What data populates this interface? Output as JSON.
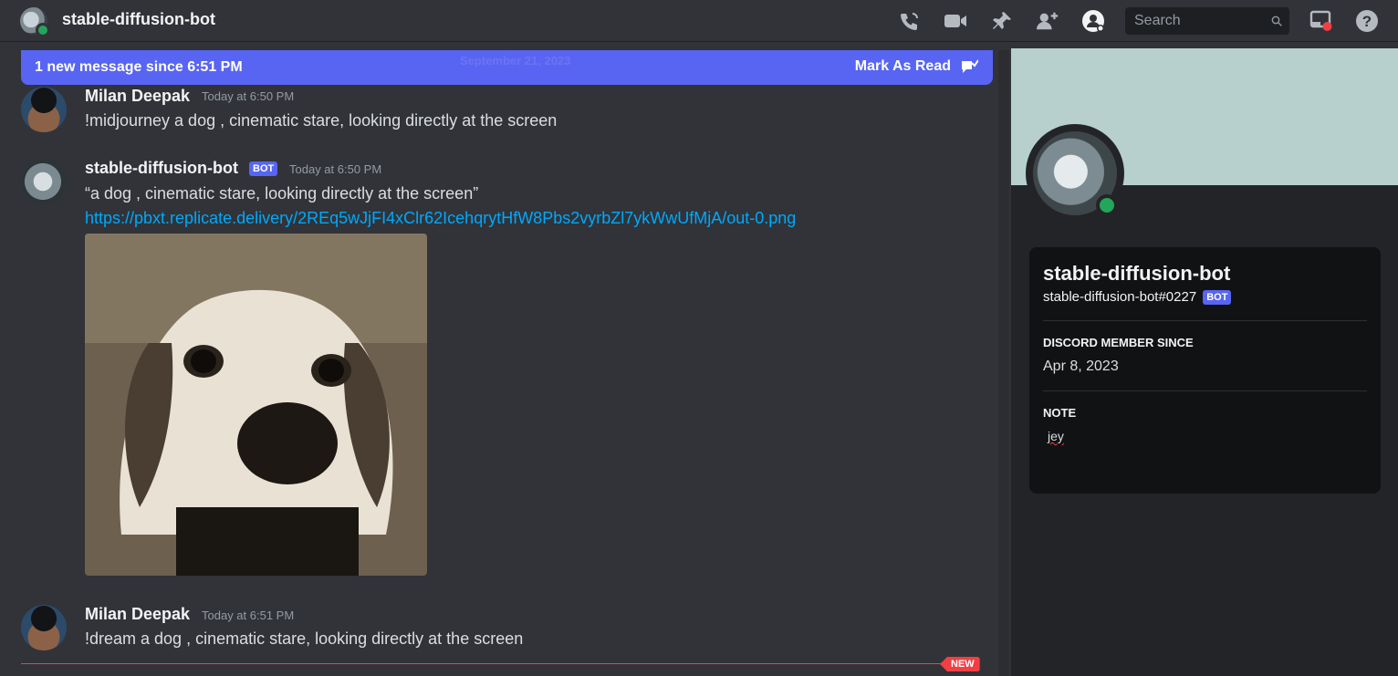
{
  "header": {
    "title": "stable-diffusion-bot",
    "icons": [
      "threads-icon",
      "video-icon",
      "pin-icon",
      "add-member-icon",
      "profile-icon",
      "inbox-icon",
      "help-icon"
    ],
    "search_placeholder": "Search"
  },
  "banner": {
    "text": "1 new message since 6:51 PM",
    "date_divider": "September 21, 2023",
    "mark_read": "Mark As Read"
  },
  "messages": [
    {
      "author": "Milan Deepak",
      "time": "Today at 6:50 PM",
      "content": "!midjourney a dog , cinematic stare, looking directly at the screen"
    },
    {
      "author": "stable-diffusion-bot",
      "bot_tag": "BOT",
      "time": "Today at 6:50 PM",
      "content": "“a dog , cinematic stare, looking directly at the screen”",
      "link": "https://pbxt.replicate.delivery/2REq5wJjFI4xClr62IcehqrytHfW8Pbs2vyrbZl7ykWwUfMjA/out-0.png"
    },
    {
      "author": "Milan Deepak",
      "time": "Today at 6:51 PM",
      "content": "!dream a dog , cinematic stare, looking directly at the screen"
    }
  ],
  "new_badge": "NEW",
  "profile": {
    "name": "stable-diffusion-bot",
    "tag": "stable-diffusion-bot#0227",
    "bot_tag": "BOT",
    "member_since_label": "DISCORD MEMBER SINCE",
    "member_since": "Apr 8, 2023",
    "note_label": "NOTE",
    "note": "jey"
  },
  "colors": {
    "accent": "#5865f2",
    "online": "#23a55a",
    "new_marker": "#f23f43",
    "link": "#00a8fc",
    "profile_banner": "#b7d0cd"
  }
}
